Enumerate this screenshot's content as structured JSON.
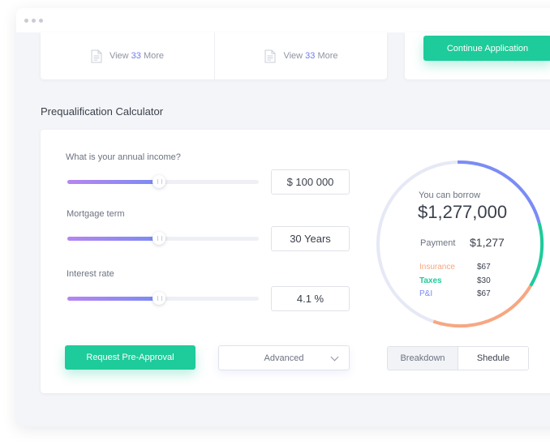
{
  "top_cards": {
    "view_more_left": {
      "prefix": "View",
      "count": "33",
      "suffix": "More"
    },
    "view_more_right": {
      "prefix": "View",
      "count": "33",
      "suffix": "More"
    },
    "continue_label": "Continue Application"
  },
  "calculator": {
    "title": "Prequalification Calculator",
    "fields": [
      {
        "label": "What is your annual income?",
        "value": "$ 100 000",
        "slider_fraction": 0.48
      },
      {
        "label": "Mortgage term",
        "value": "30 Years",
        "slider_fraction": 0.48
      },
      {
        "label": "Interest rate",
        "value": "4.1 %",
        "slider_fraction": 0.48
      }
    ],
    "request_label": "Request Pre-Approval",
    "advanced_label": "Advanced",
    "tabs": [
      "Breakdown",
      "Shedule"
    ]
  },
  "summary": {
    "borrow_label": "You can borrow",
    "borrow_value": "$1,277,000",
    "payment_label": "Payment",
    "payment_value": "$1,277",
    "items": [
      {
        "label": "Insurance",
        "value": "$67",
        "color": "#f7a781"
      },
      {
        "label": "Taxes",
        "value": "$30",
        "color": "#1ecb9a"
      },
      {
        "label": "P&I",
        "value": "$67",
        "color": "#7a8cf4"
      }
    ]
  },
  "colors": {
    "accent_green": "#1ecb9a",
    "accent_purple": "#7a8cf4",
    "accent_orange": "#f7a781",
    "link_blue": "#6e7cf0"
  },
  "icons": {
    "document": "doc-icon",
    "chevron": "chevron-down-icon"
  }
}
